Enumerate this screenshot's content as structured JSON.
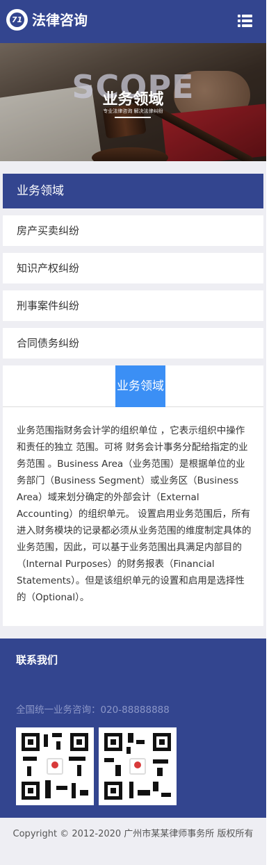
{
  "header": {
    "logo_mark": "71",
    "logo_text": "法律咨询",
    "menu_icon": "list-menu-icon"
  },
  "banner": {
    "watermark": "SCOPE",
    "title": "业务领域",
    "subtitle": "专业法律咨询 解决法律纠纷"
  },
  "categories": {
    "heading": "业务领域",
    "items": [
      {
        "label": "房产买卖纠纷"
      },
      {
        "label": "知识产权纠纷"
      },
      {
        "label": "刑事案件纠纷"
      },
      {
        "label": "合同债务纠纷"
      }
    ]
  },
  "content": {
    "tab_label": "业务领域",
    "description": "业务范围指财务会计学的组织单位 ，它表示组织中操作和责任的独立 范围。可将 财务会计事务分配给指定的业务范围 。Business Area（业务范围）是根据单位的业务部门（Business Segment）或业务区（Business Area）域来划分确定的外部会计（External Accounting）的组织单元。 设置启用业务范围后，所有进入财务模块的记录都必须从业务范围的维度制定具体的业务范围，因此，可以基于业务范围出具满足内部目的（Internal Purposes）的财务报表（Financial Statements）。但是该组织单元的设置和启用是选择性的（Optional）。"
  },
  "footer": {
    "title": "联系我们",
    "phone_line": "全国统一业务咨询：020-88888888",
    "qr_codes": [
      "qr-code-icon",
      "qr-code-icon"
    ],
    "copyright": "Copyright © 2012-2020 广州市某某律师事务所 版权所有"
  },
  "colors": {
    "brand": "#33458f",
    "accent": "#3b8ff5",
    "background": "#eeeef3"
  }
}
